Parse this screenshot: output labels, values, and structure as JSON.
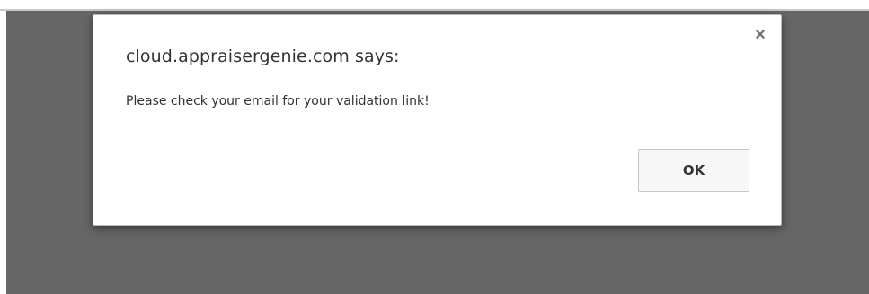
{
  "dialog": {
    "title": "cloud.appraisergenie.com says:",
    "message": "Please check your email for your validation link!",
    "close_glyph": "×",
    "close_icon": "close-icon",
    "ok_label": "OK"
  },
  "colors": {
    "overlay": "#666666",
    "dialog_bg": "#ffffff",
    "button_bg": "#f7f7f7"
  }
}
